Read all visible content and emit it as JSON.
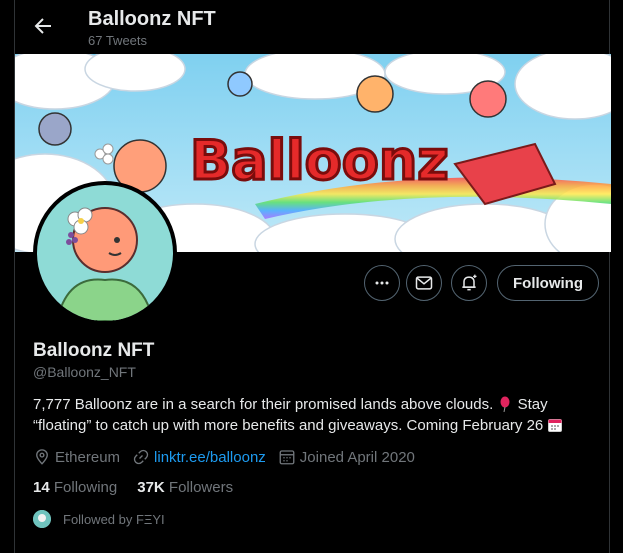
{
  "header": {
    "title": "Balloonz NFT",
    "tweet_count": "67 Tweets"
  },
  "banner": {
    "logo_text": "Balloonz"
  },
  "actions": {
    "follow_label": "Following"
  },
  "profile": {
    "name": "Balloonz NFT",
    "handle": "@Balloonz_NFT",
    "bio_line1": "7,777 Balloonz are in a search for their promised lands above clouds. ",
    "bio_line1b": " Stay",
    "bio_line2": "“floating” to catch up with more benefits and giveaways. Coming February 26 ",
    "location": "Ethereum",
    "website": "linktr.ee/balloonz",
    "joined": "Joined April 2020"
  },
  "stats": {
    "following_count": "14",
    "following_label": "Following",
    "followers_count": "37K",
    "followers_label": "Followers"
  },
  "followed_by": "Followed by FΞYI",
  "colors": {
    "background": "#000000",
    "text": "#e7e9ea",
    "muted": "#71767b",
    "link": "#1d9bf0",
    "border": "#536471"
  }
}
